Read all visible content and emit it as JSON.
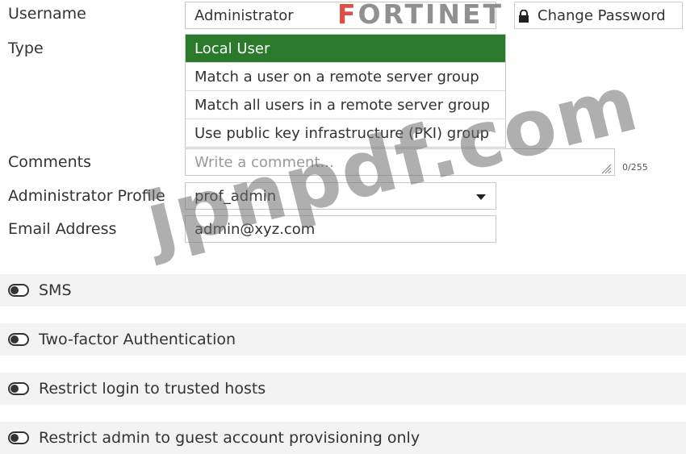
{
  "brand": {
    "logo_text": "FORTINET"
  },
  "form": {
    "username": {
      "label": "Username",
      "value": "Administrator"
    },
    "change_password": {
      "label": "Change Password"
    },
    "type": {
      "label": "Type",
      "options": [
        "Local User",
        "Match a user on a remote server group",
        "Match all users in a remote server group",
        "Use public key infrastructure (PKI) group"
      ],
      "selected": "Local User"
    },
    "comments": {
      "label": "Comments",
      "placeholder": "Write a comment...",
      "counter": "0/255"
    },
    "admin_profile": {
      "label": "Administrator Profile",
      "value": "prof_admin"
    },
    "email": {
      "label": "Email Address",
      "value": "admin@xyz.com"
    }
  },
  "toggles": [
    {
      "label": "SMS",
      "enabled": false
    },
    {
      "label": "Two-factor Authentication",
      "enabled": false
    },
    {
      "label": "Restrict login to trusted hosts",
      "enabled": false
    },
    {
      "label": "Restrict admin to guest account provisioning only",
      "enabled": false
    }
  ],
  "watermark": "jpnpdf.com",
  "colors": {
    "selected_option": "#2b7a2b",
    "toggle_off": "#333333",
    "band_bg": "#f3f3f3"
  }
}
